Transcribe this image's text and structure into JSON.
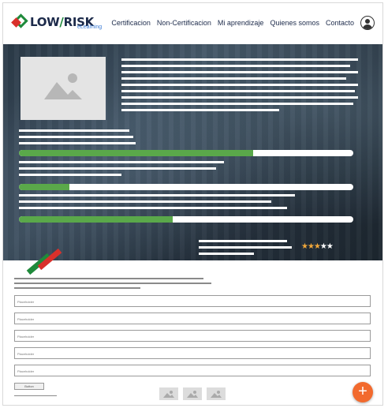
{
  "brand": {
    "name_left": "LOW",
    "name_right": "RISK",
    "subtitle": "eLearning",
    "colors": {
      "green": "#1f8a3b",
      "red": "#d9302b",
      "navy": "#1c2a4a"
    }
  },
  "nav": {
    "items": [
      {
        "label": "Certificacion"
      },
      {
        "label": "Non-Certificacion"
      },
      {
        "label": "Mi aprendizaje"
      },
      {
        "label": "Quienes somos"
      },
      {
        "label": "Contacto"
      }
    ],
    "user_icon": "user-circle-icon"
  },
  "hero": {
    "thumbnail_icon": "image-placeholder-icon",
    "progress": [
      {
        "fill_fraction": 0.7
      },
      {
        "fill_fraction": 0.15
      },
      {
        "fill_fraction": 0.46
      }
    ],
    "rating": {
      "value": 3,
      "max": 5,
      "star_color": "#f0a73a"
    }
  },
  "form": {
    "fields": [
      {
        "placeholder": "Placeholder"
      },
      {
        "placeholder": "Placeholder"
      },
      {
        "placeholder": "Placeholder"
      },
      {
        "placeholder": "Placeholder"
      },
      {
        "placeholder": "Placeholder"
      }
    ],
    "submit_label": "Button",
    "image_buttons": [
      "image-icon",
      "image-icon",
      "image-icon"
    ]
  },
  "fab": {
    "label": "+",
    "color": "#f26a2e"
  }
}
